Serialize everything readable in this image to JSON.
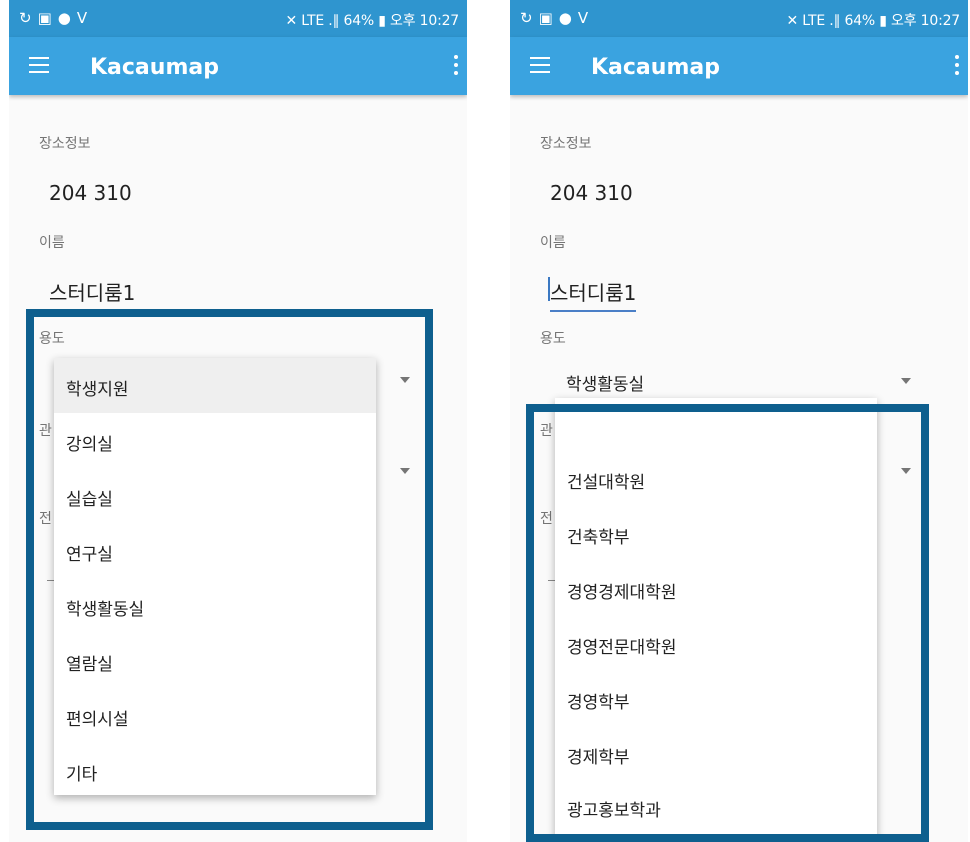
{
  "status_bar": {
    "left_icons": [
      "sync-icon",
      "gallery-icon",
      "messenger-icon",
      "v-app-icon"
    ],
    "right_text": "✕ LTE .∥ 64% ▮ 오후 10:27"
  },
  "app_bar": {
    "title": "Kacaumap",
    "menu_icon": "hamburger-menu-icon",
    "overflow_icon": "more-vert-icon"
  },
  "form": {
    "place_info_label": "장소정보",
    "place_info_value": "204 310",
    "name_label": "이름",
    "name_value": "스터디룸1",
    "usage_label": "용도",
    "department_label_partial": "관",
    "other_label_partial": "전"
  },
  "left_screen": {
    "usage_dropdown_options": [
      "학생지원",
      "강의실",
      "실습실",
      "연구실",
      "학생활동실",
      "열람실",
      "편의시설",
      "기타"
    ],
    "selected_option": "학생지원"
  },
  "right_screen": {
    "usage_selected": "학생활동실",
    "department_dropdown_options": [
      "건설대학원",
      "건축학부",
      "경영경제대학원",
      "경영전문대학원",
      "경영학부",
      "경제학부",
      "광고홍보학과"
    ]
  },
  "colors": {
    "status_bar": "#2f95cf",
    "app_bar": "#3aa3e0",
    "highlight": "#0e5f8e",
    "underline": "#4a7fc7"
  }
}
